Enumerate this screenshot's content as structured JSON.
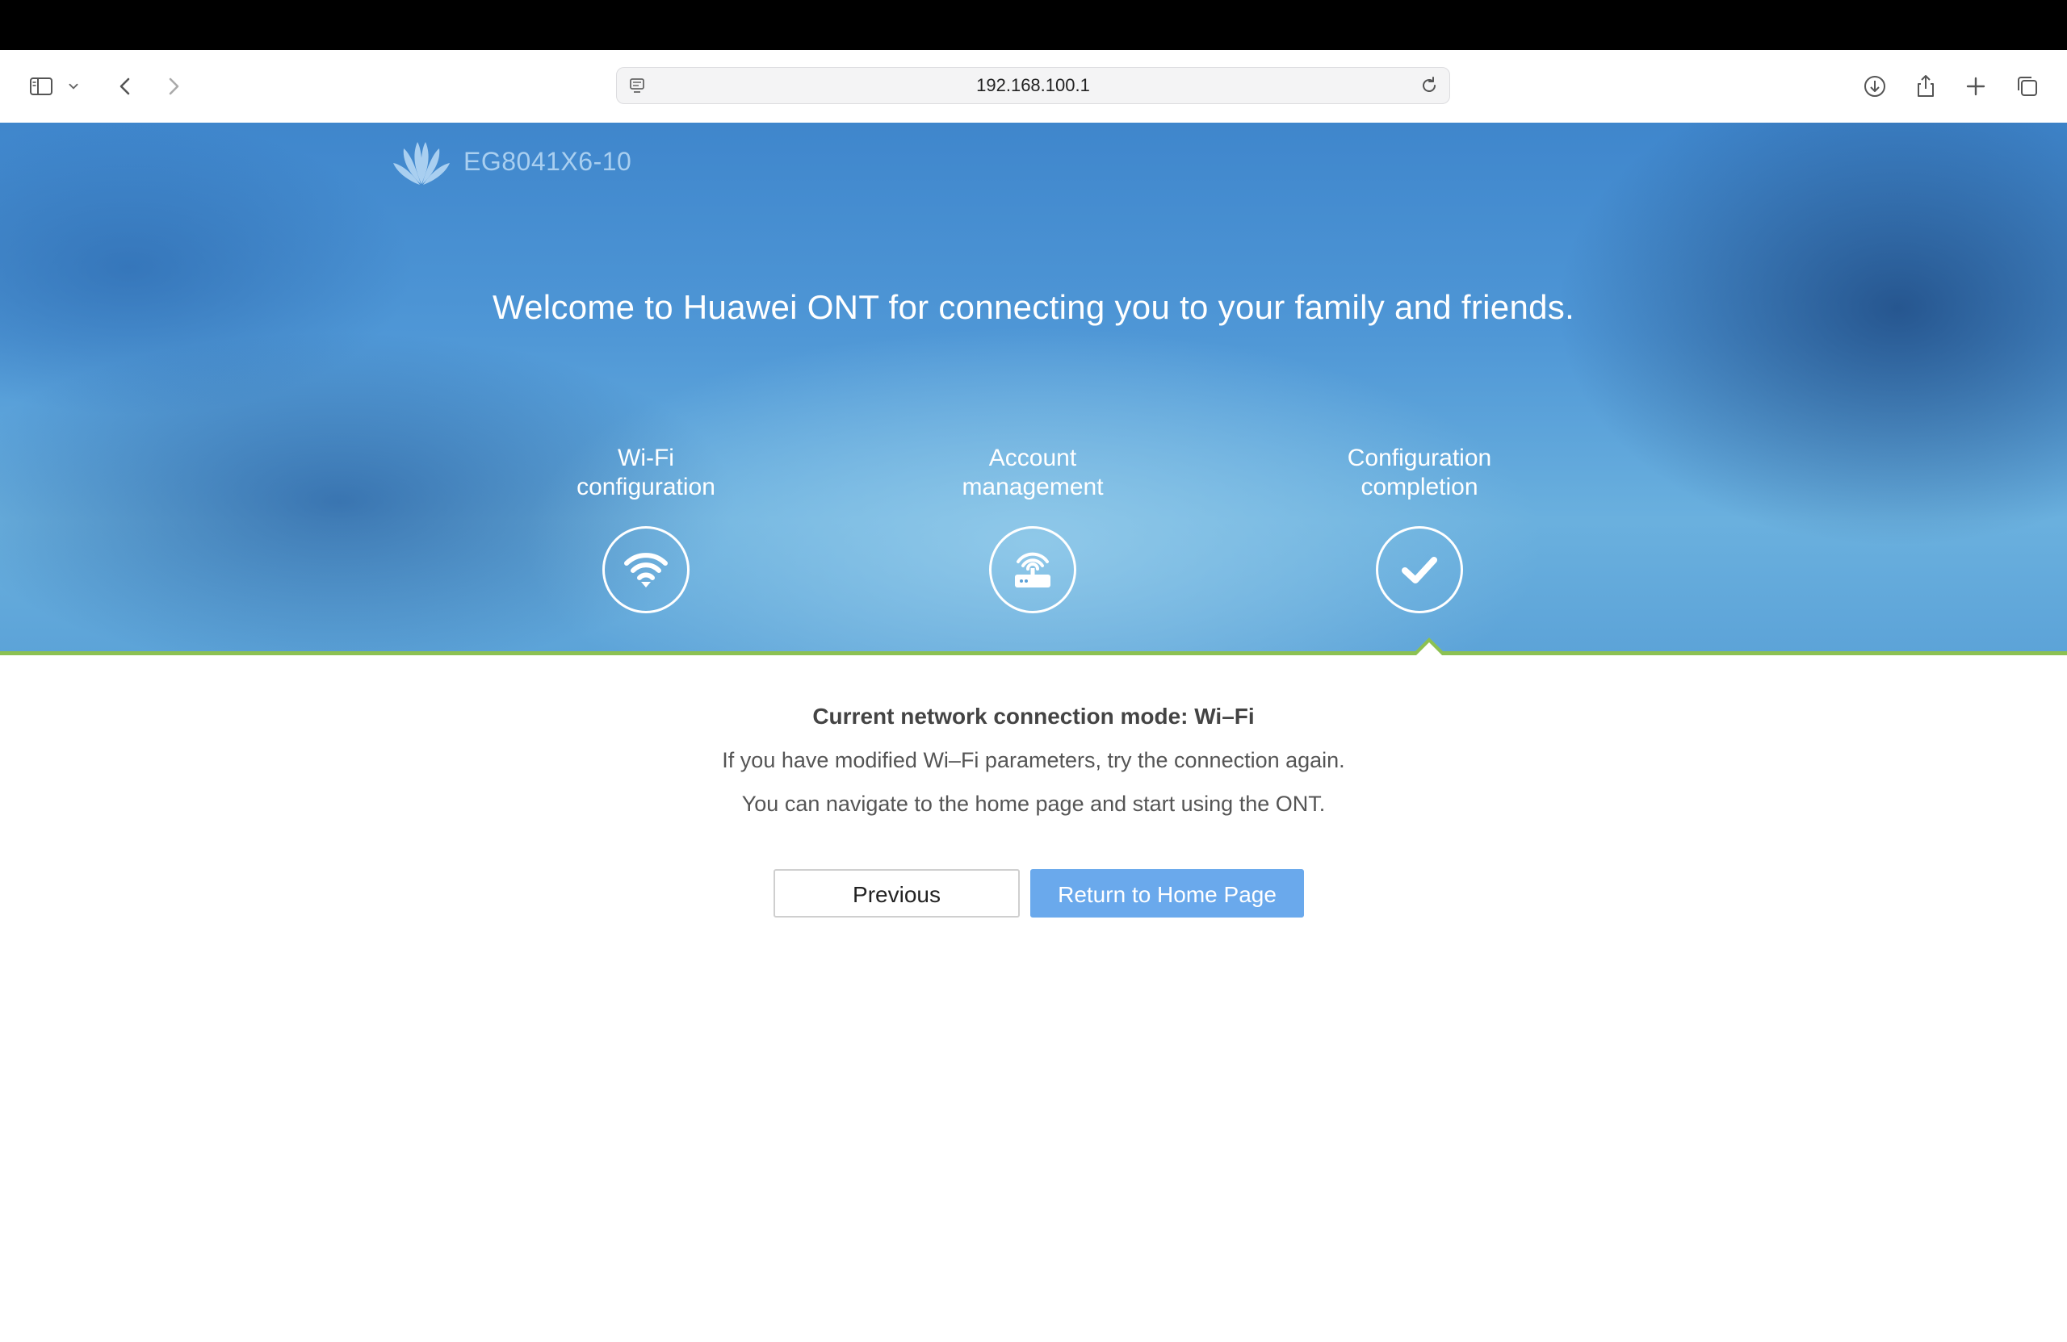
{
  "browser": {
    "url": "192.168.100.1",
    "icons": [
      "sidebar-icon",
      "chevron-down-icon",
      "back-icon",
      "forward-icon",
      "site-settings-icon",
      "reload-icon",
      "download-icon",
      "share-icon",
      "new-tab-icon",
      "tabs-overview-icon"
    ]
  },
  "header": {
    "brand_logo": "huawei-logo-icon",
    "model": "EG8041X6-10",
    "welcome": "Welcome to Huawei ONT for connecting you to your family and friends."
  },
  "steps": [
    {
      "line1": "Wi-Fi",
      "line2": "configuration",
      "icon": "wifi-icon"
    },
    {
      "line1": "Account",
      "line2": "management",
      "icon": "router-icon"
    },
    {
      "line1": "Configuration",
      "line2": "completion",
      "icon": "checkmark-icon",
      "active": true
    }
  ],
  "main": {
    "mode": "Current network connection mode: Wi–Fi",
    "info1": "If you have modified Wi–Fi parameters, try the connection again.",
    "info2": "You can navigate to the home page and start using the ONT."
  },
  "buttons": {
    "previous": "Previous",
    "home": "Return to Home Page"
  },
  "colors": {
    "accent_button": "#6aa9ec",
    "progress_line": "#8cc152",
    "hero_blue": "#4f97d6"
  }
}
